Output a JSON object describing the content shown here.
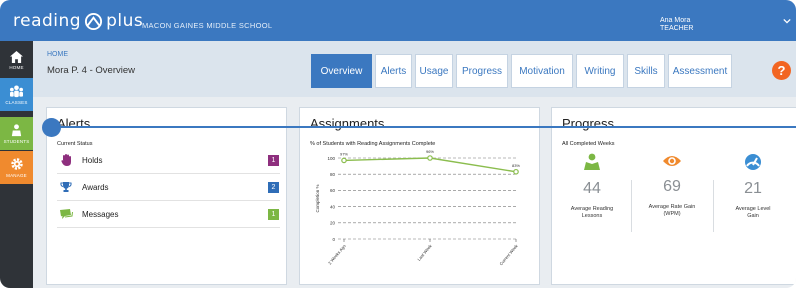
{
  "app": {
    "logo_left": "reading",
    "logo_right": "plus",
    "school": "MACON GAINES MIDDLE SCHOOL",
    "user_name": "Ana Mora",
    "user_role": "TEACHER"
  },
  "nav": {
    "home": "HOME",
    "classes": "CLASSES",
    "students": "STUDENTS",
    "manage": "MANAGE"
  },
  "header": {
    "breadcrumb": "HOME",
    "title": "Mora P. 4 - Overview",
    "tabs": [
      "Overview",
      "Alerts",
      "Usage",
      "Progress",
      "Motivation",
      "Writing",
      "Skills",
      "Assessment"
    ],
    "active_tab": 0,
    "help": "?"
  },
  "alerts": {
    "title": "Alerts",
    "subtitle": "Current Status",
    "items": [
      {
        "label": "Holds",
        "count": "1",
        "color": "#8e2f7e",
        "icon": "hand-icon"
      },
      {
        "label": "Awards",
        "count": "2",
        "color": "#2f6db7",
        "icon": "trophy-icon"
      },
      {
        "label": "Messages",
        "count": "1",
        "color": "#7cb744",
        "icon": "message-icon"
      }
    ]
  },
  "assignments": {
    "title": "Assignments",
    "subtitle": "% of Students with Reading Assignments Complete"
  },
  "chart_data": {
    "type": "line",
    "categories": [
      "2 Weeks Ago",
      "Last Week",
      "Current Week"
    ],
    "values": [
      97,
      100,
      83
    ],
    "data_labels": [
      "97%",
      "96%",
      "83%"
    ],
    "ylabel": "Completion %",
    "yticks": [
      "100",
      "80",
      "60",
      "40",
      "20",
      "0"
    ],
    "ylim": [
      0,
      100
    ],
    "color": "#8bbd4e"
  },
  "progress": {
    "title": "Progress",
    "subtitle": "All Completed Weeks",
    "stats": [
      {
        "value": "44",
        "label1": "Average Reading",
        "label2": "Lessons",
        "icon": "reader-icon",
        "color": "#7cb744"
      },
      {
        "value": "69",
        "label1": "Average Rate Gain",
        "label2": "(WPM)",
        "icon": "eye-icon",
        "color": "#f08a2e"
      },
      {
        "value": "21",
        "label1": "Average Level",
        "label2": "Gain",
        "icon": "gauge-icon",
        "color": "#3b8ed3"
      }
    ]
  },
  "colors": {
    "brand": "#3b78c0",
    "accent_orange": "#f26522"
  }
}
